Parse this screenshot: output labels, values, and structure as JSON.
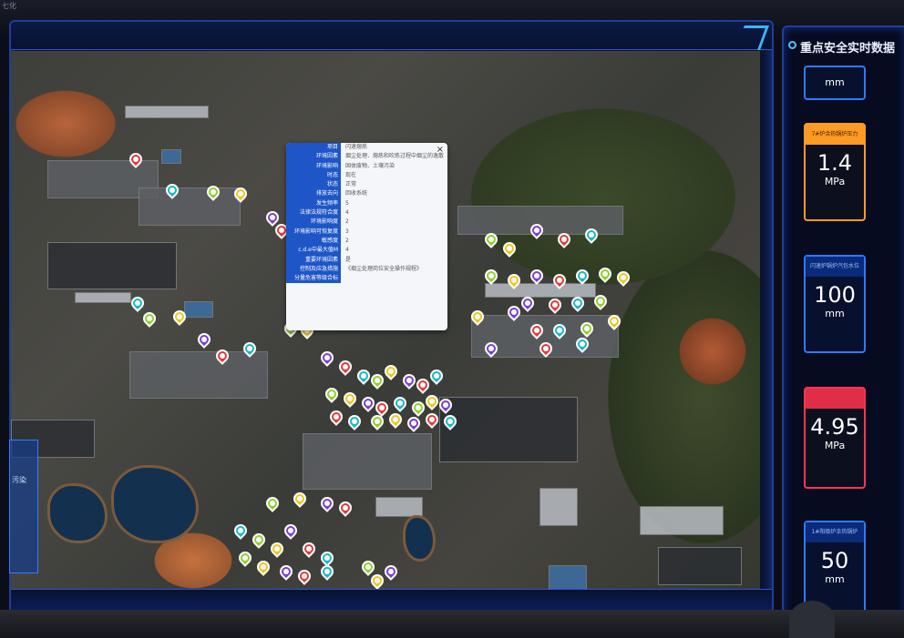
{
  "window": {
    "corner_text": "七化"
  },
  "right_panel": {
    "title": "重点安全实时数据",
    "cards": [
      {
        "label": "",
        "value": "",
        "unit": "mm",
        "style": "blue"
      },
      {
        "label": "7#炉余热锅炉压力",
        "value": "1.4",
        "unit": "MPa",
        "style": "orange"
      },
      {
        "label": "闪速炉锅炉汽包水位",
        "value": "100",
        "unit": "mm",
        "style": "blue"
      },
      {
        "label": "",
        "value": "4.95",
        "unit": "MPa",
        "style": "red"
      },
      {
        "label": "1#阳极炉余热锅炉",
        "value": "50",
        "unit": "mm",
        "style": "blue"
      }
    ]
  },
  "left_panel": {
    "label": "污染"
  },
  "popup": {
    "close_label": "×",
    "rows": [
      {
        "key": "项目",
        "val": "闪速熔炼"
      },
      {
        "key": "环境因素",
        "val": "烟尘处理、熔炼和吹炼过程中烟尘的逸散"
      },
      {
        "key": "环境影响",
        "val": "固体废物、土壤污染"
      },
      {
        "key": "时态",
        "val": "现在"
      },
      {
        "key": "状态",
        "val": "正常"
      },
      {
        "key": "排放去向",
        "val": "回收系统"
      },
      {
        "key": "发生频率",
        "val": "5"
      },
      {
        "key": "法律法规符合度",
        "val": "4"
      },
      {
        "key": "环境影响度",
        "val": "2"
      },
      {
        "key": "环境影响可恢复度",
        "val": "3"
      },
      {
        "key": "敏感度",
        "val": "2"
      },
      {
        "key": "c.d.e中最大值M",
        "val": "4"
      },
      {
        "key": "重要环境因素",
        "val": "是"
      },
      {
        "key": "控制及应急措施",
        "val": "《烟尘处理岗位安全操作规程》"
      },
      {
        "key": "分量危害等级合标",
        "val": ""
      }
    ]
  },
  "colors": {
    "accent": "#2f7bff",
    "orange": "#ff9b24",
    "red": "#ff3550",
    "popup_key": "#1e56c8",
    "pin_colors": [
      "#e03a3a",
      "#18b6c9",
      "#8fcf2a",
      "#f0c419",
      "#7a3fd1"
    ]
  },
  "icons": {
    "pin": "map-marker-icon",
    "ring": "ring-bullet-icon",
    "close": "close-icon"
  }
}
